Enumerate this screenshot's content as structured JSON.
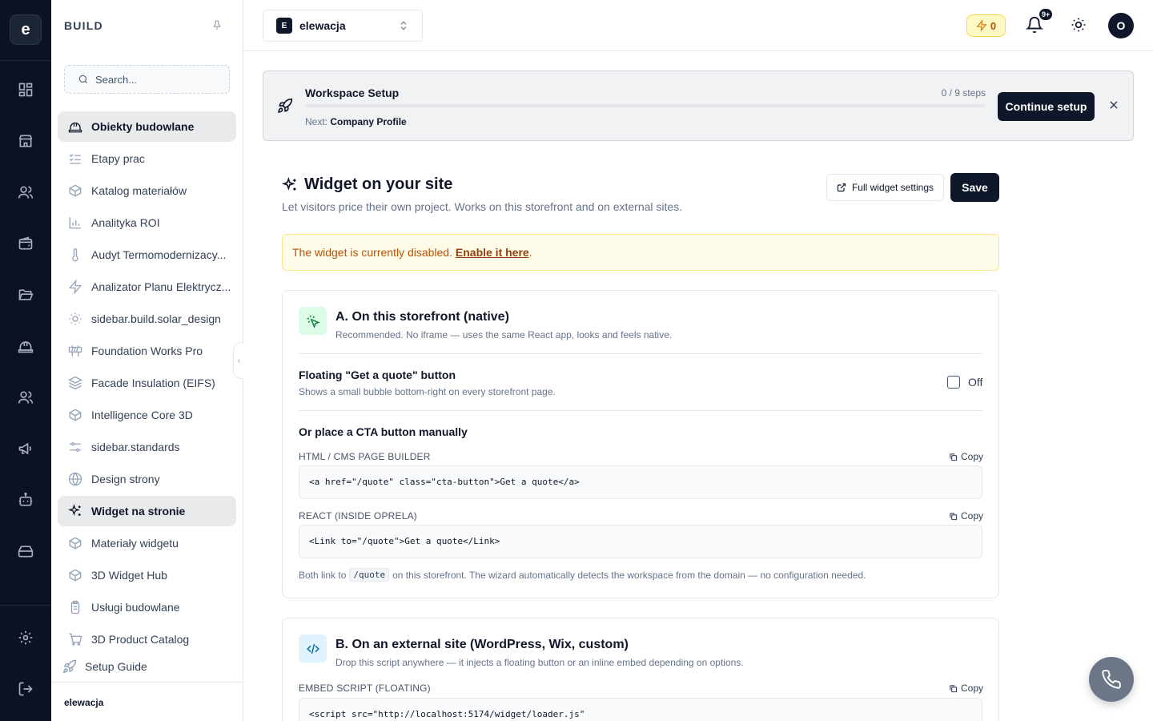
{
  "rail": {
    "logo": "e"
  },
  "sidebar": {
    "title": "BUILD",
    "search_placeholder": "Search...",
    "items": [
      {
        "label": "Obiekty budowlane",
        "icon": "hard-hat-icon",
        "active": true
      },
      {
        "label": "Etapy prac",
        "icon": "list-checks-icon",
        "active": false
      },
      {
        "label": "Katalog materiałów",
        "icon": "box-icon",
        "active": false
      },
      {
        "label": "Analityka ROI",
        "icon": "bar-chart-icon",
        "active": false
      },
      {
        "label": "Audyt Termomodernizacy...",
        "icon": "thermometer-icon",
        "active": false
      },
      {
        "label": "Analizator Planu Elektrycz...",
        "icon": "zap-icon",
        "active": false
      },
      {
        "label": "sidebar.build.solar_design",
        "icon": "sun-icon",
        "active": false
      },
      {
        "label": "Foundation Works Pro",
        "icon": "construction-icon",
        "active": false
      },
      {
        "label": "Facade Insulation (EIFS)",
        "icon": "layers-icon",
        "active": false
      },
      {
        "label": "Intelligence Core 3D",
        "icon": "box-icon",
        "active": false
      },
      {
        "label": "sidebar.standards",
        "icon": "sliders-icon",
        "active": false
      },
      {
        "label": "Design strony",
        "icon": "globe-icon",
        "active": false
      },
      {
        "label": "Widget na stronie",
        "icon": "sparkles-icon",
        "active": true
      },
      {
        "label": "Materiały widgetu",
        "icon": "box-icon",
        "active": false
      },
      {
        "label": "3D Widget Hub",
        "icon": "box-icon",
        "active": false
      },
      {
        "label": "Usługi budowlane",
        "icon": "clipboard-icon",
        "active": false
      },
      {
        "label": "3D Product Catalog",
        "icon": "cart-icon",
        "active": false
      }
    ],
    "setup_guide": "Setup Guide",
    "footer_workspace": "elewacja"
  },
  "header": {
    "workspace_badge": "E",
    "workspace_name": "elewacja",
    "credits": "0",
    "notification_count": "9+",
    "avatar_initial": "O"
  },
  "setup": {
    "title": "Workspace Setup",
    "steps": "0 / 9 steps",
    "progress": 0,
    "next_label": "Next:",
    "next_value": "Company Profile",
    "button": "Continue setup"
  },
  "widget": {
    "title": "Widget on your site",
    "subtitle": "Let visitors price their own project. Works on this storefront and on external sites.",
    "settings_button": "Full widget settings",
    "save_button": "Save",
    "alert_text": "The widget is currently disabled.",
    "alert_link": "Enable it here",
    "alert_end": "."
  },
  "card_a": {
    "title": "A. On this storefront (native)",
    "subtitle": "Recommended. No iframe — uses the same React app, looks and feels native.",
    "floating_title": "Floating \"Get a quote\" button",
    "floating_sub": "Shows a small bubble bottom-right on every storefront page.",
    "toggle_label": "Off",
    "manual_title": "Or place a CTA button manually",
    "html_caption": "HTML / CMS PAGE BUILDER",
    "html_code": "<a href=\"/quote\" class=\"cta-button\">Get a quote</a>",
    "react_caption": "REACT (INSIDE OPRELA)",
    "react_code": "<Link to=\"/quote\">Get a quote</Link>",
    "copy_label": "Copy",
    "note_before": "Both link to",
    "note_code": "/quote",
    "note_after": "on this storefront. The wizard automatically detects the workspace from the domain — no configuration needed."
  },
  "card_b": {
    "title": "B. On an external site (WordPress, Wix, custom)",
    "subtitle": "Drop this script anywhere — it injects a floating button or an inline embed depending on options.",
    "embed_caption": "EMBED SCRIPT (FLOATING)",
    "copy_label": "Copy",
    "embed_code": "<script src=\"http://localhost:5174/widget/loader.js\""
  },
  "colors": {
    "rail_bg": "#0b1222",
    "primary": "#0f172a",
    "warning_bg": "#fefbe8",
    "warning_text": "#b45309"
  }
}
